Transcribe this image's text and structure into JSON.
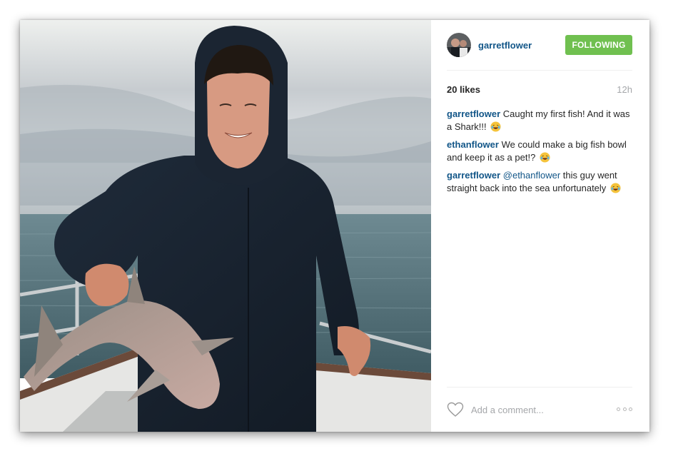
{
  "post": {
    "username": "garretflower",
    "follow_label": "FOLLOWING",
    "likes": "20 likes",
    "time": "12h",
    "comments": [
      {
        "user": "garretflower",
        "text": "Caught my first fish! And it was a Shark!!!",
        "emoji": "crying-laughing-emoji"
      },
      {
        "user": "ethanflower",
        "text": "We could make a big fish bowl and keep it as a pet!?",
        "emoji": "crying-laughing-emoji"
      },
      {
        "user": "garretflower",
        "mention": "@ethanflower",
        "text": "this guy went straight back into the sea unfortunately",
        "emoji": "crying-laughing-emoji"
      }
    ],
    "comment_placeholder": "Add a comment..."
  },
  "colors": {
    "username": "#125688",
    "follow_button": "#70c050",
    "muted": "#a5a7aa",
    "divider": "#efefef"
  }
}
